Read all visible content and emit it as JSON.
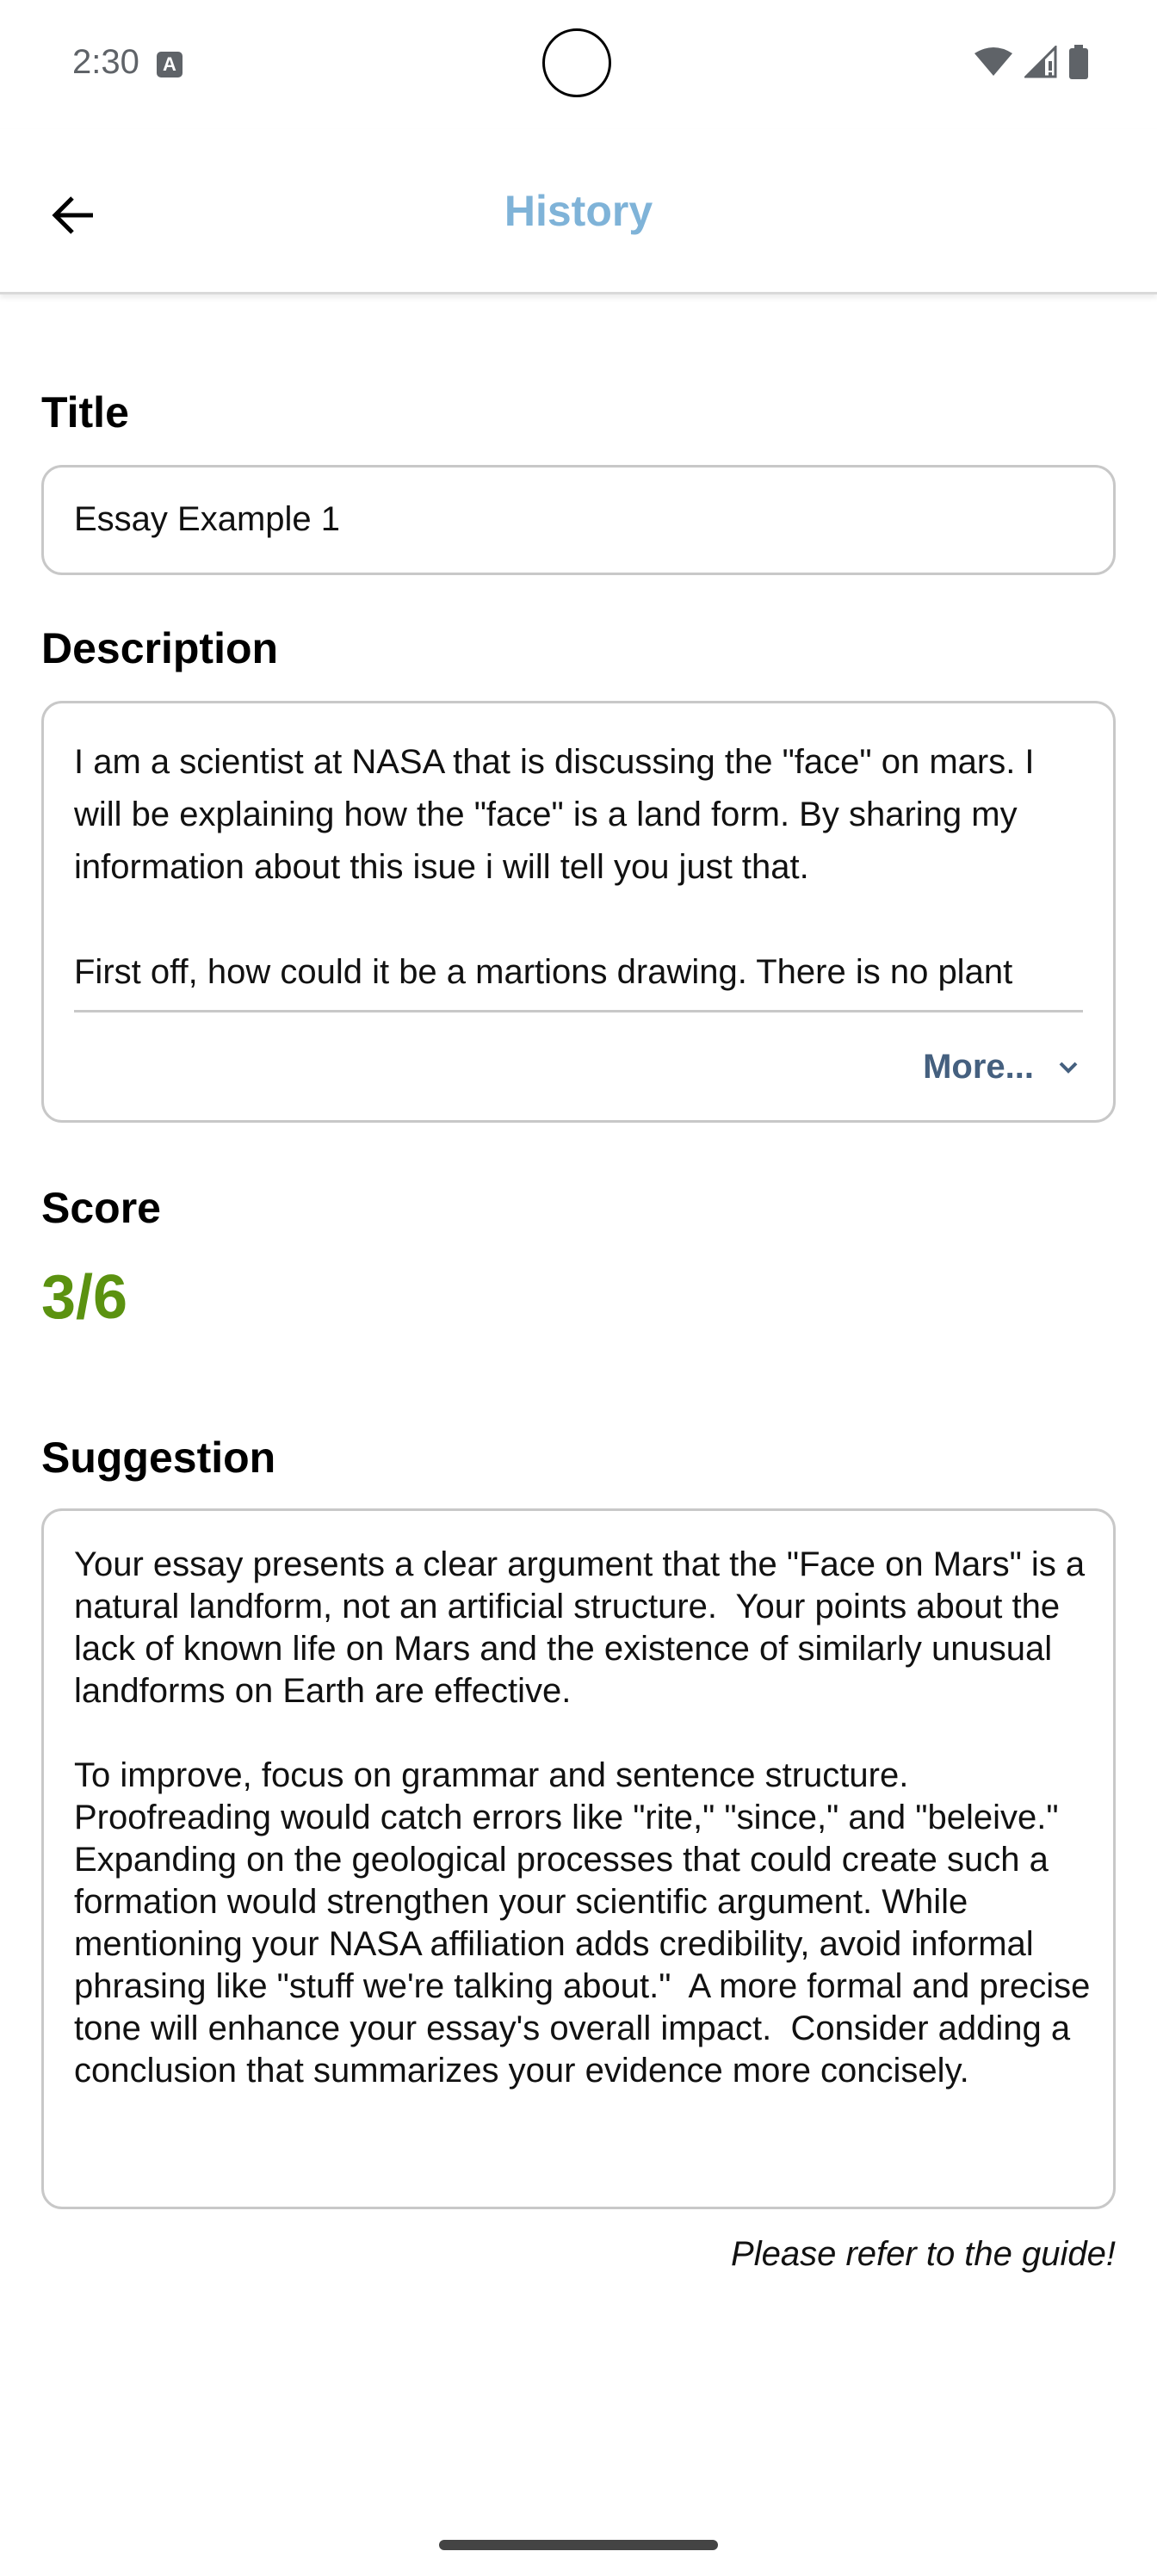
{
  "status_bar": {
    "time": "2:30",
    "icons": [
      "text-a-icon",
      "wifi-icon",
      "cell-signal-icon",
      "battery-icon"
    ]
  },
  "app_bar": {
    "title": "History",
    "title_color": "#7fb3d8"
  },
  "title_section": {
    "label": "Title",
    "value": "Essay Example 1"
  },
  "description_section": {
    "label": "Description",
    "text": "I am a scientist at NASA that is discussing the \"face\" on mars. I will be explaining how the \"face\" is a land form. By sharing my information about this isue i will tell you just that.\n\nFirst off, how could it be a martions drawing. There is no plant",
    "more_label": "More..."
  },
  "score_section": {
    "label": "Score",
    "value": "3/6",
    "value_color": "#5b9210"
  },
  "suggestion_section": {
    "label": "Suggestion",
    "text": "Your essay presents a clear argument that the \"Face on Mars\" is a natural landform, not an artificial structure.  Your points about the lack of known life on Mars and the existence of similarly unusual landforms on Earth are effective.\n\nTo improve, focus on grammar and sentence structure. Proofreading would catch errors like \"rite,\" \"since,\" and \"beleive.\" Expanding on the geological processes that could create such a formation would strengthen your scientific argument. While mentioning your NASA affiliation adds credibility, avoid informal phrasing like \"stuff we're talking about.\"  A more formal and precise tone will enhance your essay's overall impact.  Consider adding a conclusion that summarizes your evidence more concisely.",
    "note": "Please refer to the guide!"
  }
}
